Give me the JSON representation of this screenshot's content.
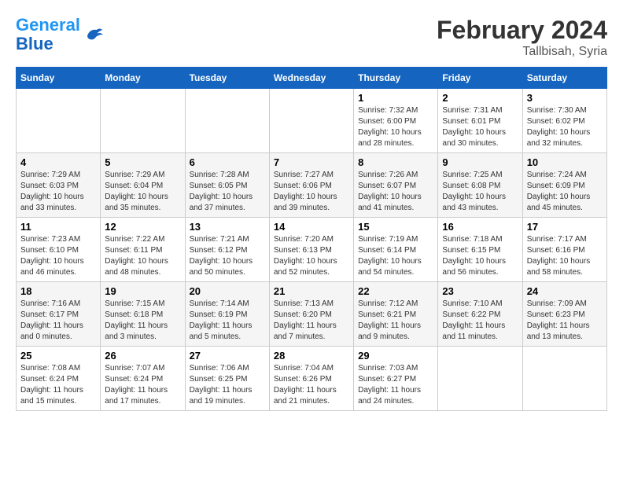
{
  "logo": {
    "general": "General",
    "blue": "Blue"
  },
  "title": "February 2024",
  "subtitle": "Tallbisah, Syria",
  "days_header": [
    "Sunday",
    "Monday",
    "Tuesday",
    "Wednesday",
    "Thursday",
    "Friday",
    "Saturday"
  ],
  "weeks": [
    [
      {
        "day": "",
        "info": ""
      },
      {
        "day": "",
        "info": ""
      },
      {
        "day": "",
        "info": ""
      },
      {
        "day": "",
        "info": ""
      },
      {
        "day": "1",
        "info": "Sunrise: 7:32 AM\nSunset: 6:00 PM\nDaylight: 10 hours\nand 28 minutes."
      },
      {
        "day": "2",
        "info": "Sunrise: 7:31 AM\nSunset: 6:01 PM\nDaylight: 10 hours\nand 30 minutes."
      },
      {
        "day": "3",
        "info": "Sunrise: 7:30 AM\nSunset: 6:02 PM\nDaylight: 10 hours\nand 32 minutes."
      }
    ],
    [
      {
        "day": "4",
        "info": "Sunrise: 7:29 AM\nSunset: 6:03 PM\nDaylight: 10 hours\nand 33 minutes."
      },
      {
        "day": "5",
        "info": "Sunrise: 7:29 AM\nSunset: 6:04 PM\nDaylight: 10 hours\nand 35 minutes."
      },
      {
        "day": "6",
        "info": "Sunrise: 7:28 AM\nSunset: 6:05 PM\nDaylight: 10 hours\nand 37 minutes."
      },
      {
        "day": "7",
        "info": "Sunrise: 7:27 AM\nSunset: 6:06 PM\nDaylight: 10 hours\nand 39 minutes."
      },
      {
        "day": "8",
        "info": "Sunrise: 7:26 AM\nSunset: 6:07 PM\nDaylight: 10 hours\nand 41 minutes."
      },
      {
        "day": "9",
        "info": "Sunrise: 7:25 AM\nSunset: 6:08 PM\nDaylight: 10 hours\nand 43 minutes."
      },
      {
        "day": "10",
        "info": "Sunrise: 7:24 AM\nSunset: 6:09 PM\nDaylight: 10 hours\nand 45 minutes."
      }
    ],
    [
      {
        "day": "11",
        "info": "Sunrise: 7:23 AM\nSunset: 6:10 PM\nDaylight: 10 hours\nand 46 minutes."
      },
      {
        "day": "12",
        "info": "Sunrise: 7:22 AM\nSunset: 6:11 PM\nDaylight: 10 hours\nand 48 minutes."
      },
      {
        "day": "13",
        "info": "Sunrise: 7:21 AM\nSunset: 6:12 PM\nDaylight: 10 hours\nand 50 minutes."
      },
      {
        "day": "14",
        "info": "Sunrise: 7:20 AM\nSunset: 6:13 PM\nDaylight: 10 hours\nand 52 minutes."
      },
      {
        "day": "15",
        "info": "Sunrise: 7:19 AM\nSunset: 6:14 PM\nDaylight: 10 hours\nand 54 minutes."
      },
      {
        "day": "16",
        "info": "Sunrise: 7:18 AM\nSunset: 6:15 PM\nDaylight: 10 hours\nand 56 minutes."
      },
      {
        "day": "17",
        "info": "Sunrise: 7:17 AM\nSunset: 6:16 PM\nDaylight: 10 hours\nand 58 minutes."
      }
    ],
    [
      {
        "day": "18",
        "info": "Sunrise: 7:16 AM\nSunset: 6:17 PM\nDaylight: 11 hours\nand 0 minutes."
      },
      {
        "day": "19",
        "info": "Sunrise: 7:15 AM\nSunset: 6:18 PM\nDaylight: 11 hours\nand 3 minutes."
      },
      {
        "day": "20",
        "info": "Sunrise: 7:14 AM\nSunset: 6:19 PM\nDaylight: 11 hours\nand 5 minutes."
      },
      {
        "day": "21",
        "info": "Sunrise: 7:13 AM\nSunset: 6:20 PM\nDaylight: 11 hours\nand 7 minutes."
      },
      {
        "day": "22",
        "info": "Sunrise: 7:12 AM\nSunset: 6:21 PM\nDaylight: 11 hours\nand 9 minutes."
      },
      {
        "day": "23",
        "info": "Sunrise: 7:10 AM\nSunset: 6:22 PM\nDaylight: 11 hours\nand 11 minutes."
      },
      {
        "day": "24",
        "info": "Sunrise: 7:09 AM\nSunset: 6:23 PM\nDaylight: 11 hours\nand 13 minutes."
      }
    ],
    [
      {
        "day": "25",
        "info": "Sunrise: 7:08 AM\nSunset: 6:24 PM\nDaylight: 11 hours\nand 15 minutes."
      },
      {
        "day": "26",
        "info": "Sunrise: 7:07 AM\nSunset: 6:24 PM\nDaylight: 11 hours\nand 17 minutes."
      },
      {
        "day": "27",
        "info": "Sunrise: 7:06 AM\nSunset: 6:25 PM\nDaylight: 11 hours\nand 19 minutes."
      },
      {
        "day": "28",
        "info": "Sunrise: 7:04 AM\nSunset: 6:26 PM\nDaylight: 11 hours\nand 21 minutes."
      },
      {
        "day": "29",
        "info": "Sunrise: 7:03 AM\nSunset: 6:27 PM\nDaylight: 11 hours\nand 24 minutes."
      },
      {
        "day": "",
        "info": ""
      },
      {
        "day": "",
        "info": ""
      }
    ]
  ]
}
